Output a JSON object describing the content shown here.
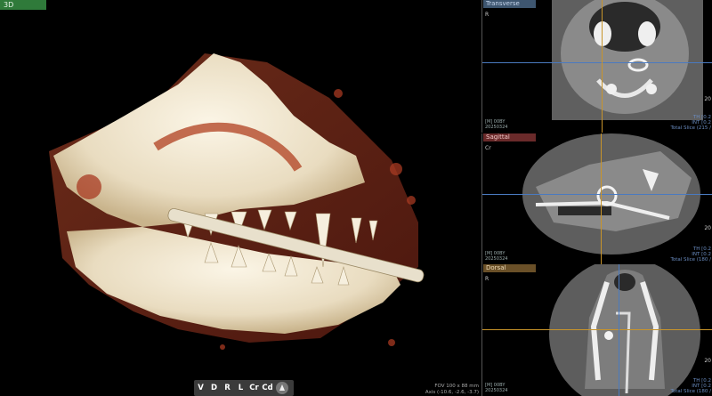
{
  "view3d": {
    "tab_label": "3D",
    "toolbar": [
      "V",
      "D",
      "R",
      "L",
      "Cr",
      "Cd"
    ],
    "fov_line1": "FOV 100 x 88 mm",
    "fov_line2": "Axis (-10.6, -2.6, -3.7)"
  },
  "panels": {
    "transverse": {
      "tab": "Transverse",
      "orient": "R",
      "side_num": "20",
      "ct1": "[M] 00BY",
      "ct2": "20250324",
      "slice1": "TH [0.2",
      "slice2": "INT [0.2",
      "slice3": "Total Slice (215 /"
    },
    "sagittal": {
      "tab": "Sagittal",
      "orient": "Cr",
      "side_num": "20",
      "ct1": "[M] 00BY",
      "ct2": "20250324",
      "slice1": "TH [0.2",
      "slice2": "INT [0.2",
      "slice3": "Total Slice (180 /"
    },
    "dorsal": {
      "tab": "Dorsal",
      "orient": "R",
      "side_num": "20",
      "ct1": "[M] 00BY",
      "ct2": "20250324",
      "slice1": "TH [0.2",
      "slice2": "INT [0.2",
      "slice3": "Total Slice (180 /"
    }
  },
  "colors": {
    "bone": "#efe6d2",
    "tissue": "#b8482e",
    "axis_blue": "#4a7ac0",
    "axis_orange": "#c8942a"
  }
}
